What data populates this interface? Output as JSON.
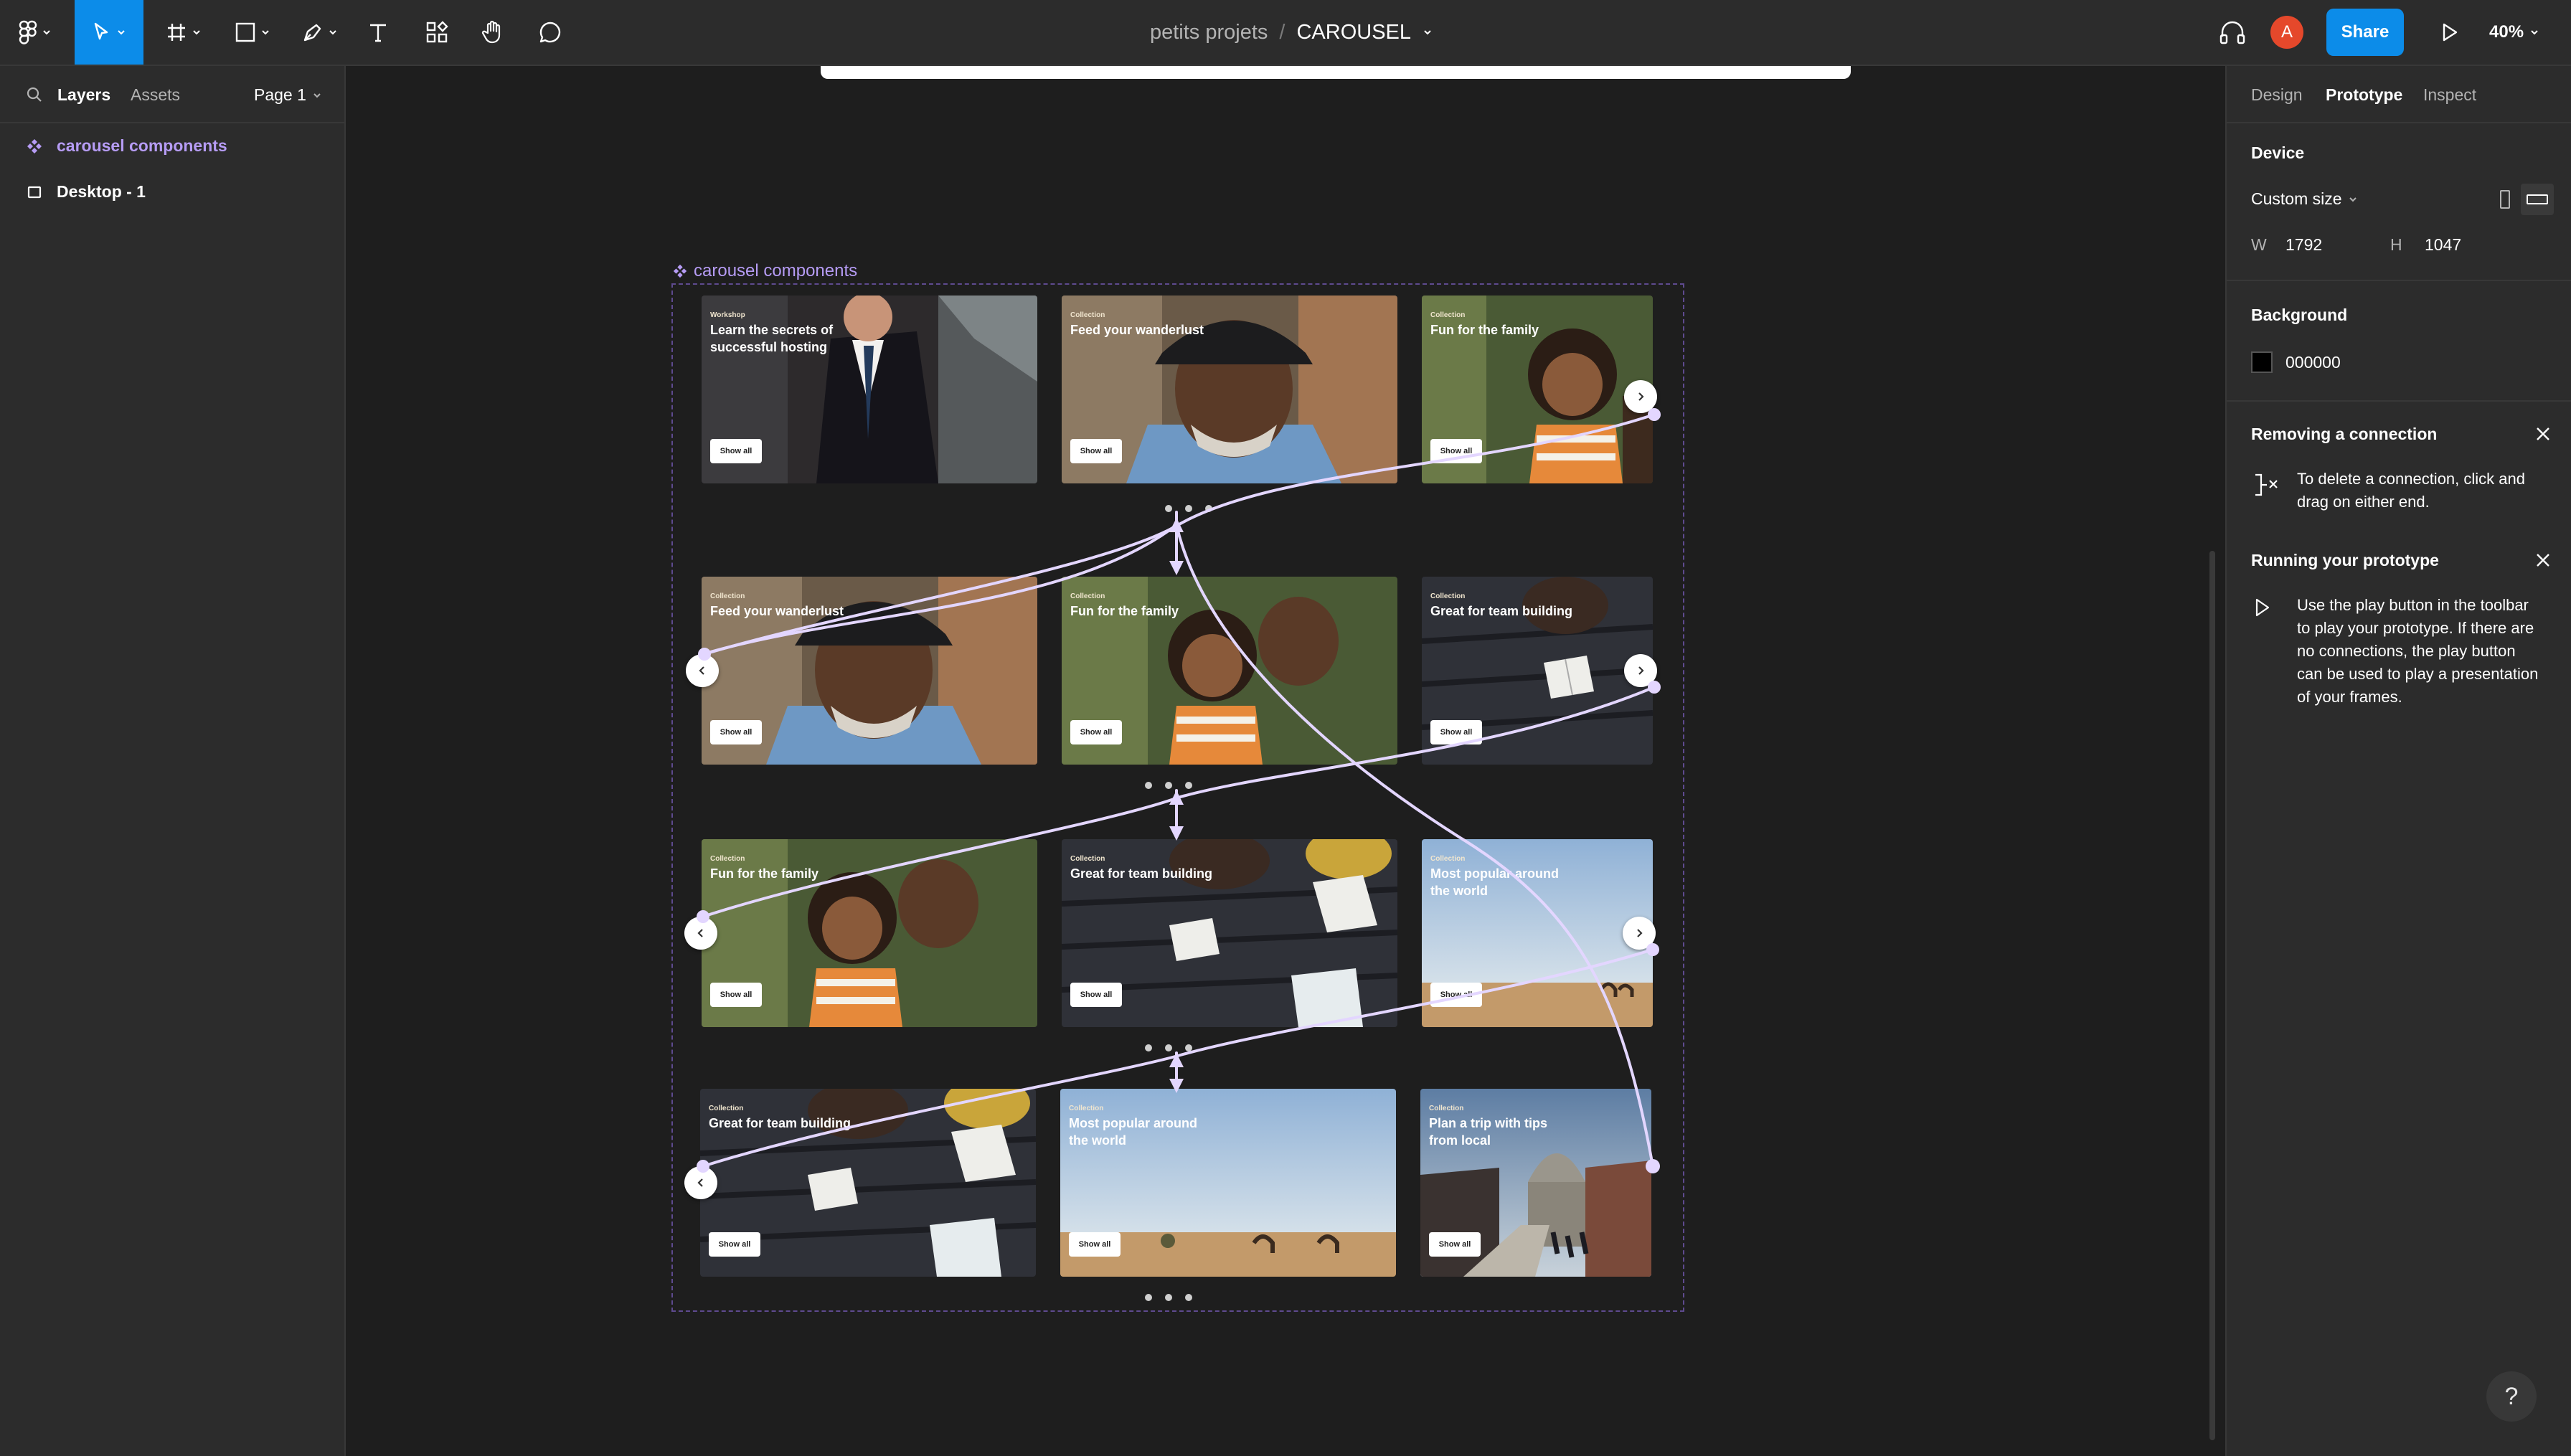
{
  "toolbar": {
    "project": "petits projets",
    "separator": "/",
    "file_name": "CAROUSEL",
    "avatar_initial": "A",
    "share_label": "Share",
    "zoom": "40%"
  },
  "left_panel": {
    "tabs": [
      "Layers",
      "Assets"
    ],
    "page": "Page 1",
    "layers": [
      {
        "label": "carousel components",
        "icon": "component-icon",
        "color": "#b69cf5"
      },
      {
        "label": "Desktop - 1",
        "icon": "frame-icon",
        "color": "#ffffff"
      }
    ]
  },
  "right_panel": {
    "tabs": [
      "Design",
      "Prototype",
      "Inspect"
    ],
    "device": {
      "heading": "Device",
      "size": "Custom size",
      "w_label": "W",
      "w": "1792",
      "h_label": "H",
      "h": "1047"
    },
    "background": {
      "heading": "Background",
      "color": "000000"
    },
    "removing": {
      "heading": "Removing a connection",
      "text": "To delete a connection, click and drag on either end."
    },
    "running": {
      "heading": "Running your prototype",
      "text": "Use the play button in the toolbar to play your prototype. If there are no connections, the play button can be used to play a presentation of your frames."
    },
    "help": "?"
  },
  "canvas": {
    "component_label": "carousel components",
    "show_all": "Show all",
    "rows": [
      {
        "cards": [
          {
            "category": "Workshop",
            "title": "Learn the secrets of successful hosting",
            "image": "man-in-suit"
          },
          {
            "category": "Collection",
            "title": "Feed your wanderlust",
            "image": "man-with-hat"
          },
          {
            "category": "Collection",
            "title": "Fun for the family",
            "image": "father-and-child"
          }
        ]
      },
      {
        "cards": [
          {
            "category": "Collection",
            "title": "Feed your wanderlust",
            "image": "man-with-hat"
          },
          {
            "category": "Collection",
            "title": "Fun for the family",
            "image": "father-and-child"
          },
          {
            "category": "Collection",
            "title": "Great for team building",
            "image": "people-reading"
          }
        ]
      },
      {
        "cards": [
          {
            "category": "Collection",
            "title": "Fun for the family",
            "image": "father-and-child"
          },
          {
            "category": "Collection",
            "title": "Great for team building",
            "image": "people-reading"
          },
          {
            "category": "Collection",
            "title": "Most popular around the world",
            "image": "desert-camels"
          }
        ]
      },
      {
        "cards": [
          {
            "category": "Collection",
            "title": "Great for team building",
            "image": "people-reading"
          },
          {
            "category": "Collection",
            "title": "Most popular around the world",
            "image": "desert-camels"
          },
          {
            "category": "Collection",
            "title": "Plan a trip with tips from local",
            "image": "london-cathedral"
          }
        ]
      }
    ]
  },
  "colors": {
    "accent": "#0c8ce9",
    "component": "#b69cf5",
    "connection": "#d8c8ff",
    "avatar": "#e5482b"
  }
}
